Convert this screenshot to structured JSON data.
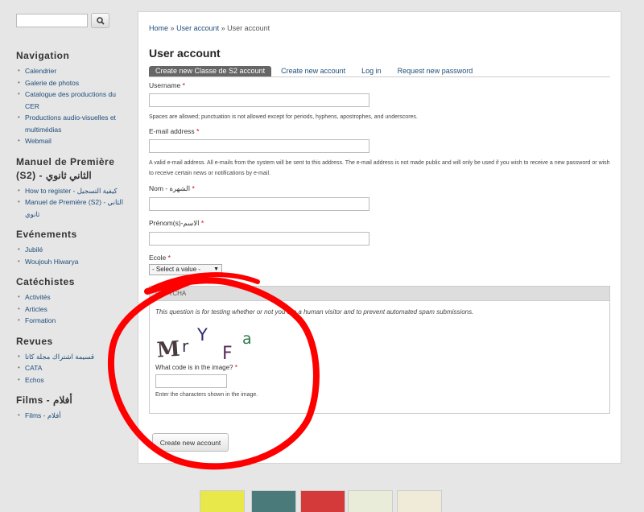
{
  "search": {
    "value": "",
    "button_icon": "search-icon"
  },
  "sidebar": {
    "blocks": [
      {
        "title": "Navigation",
        "items": [
          "Calendrier",
          "Galerie de photos",
          "Catalogue des productions du CER",
          "Productions audio-visuelles et multimédias",
          "Webmail"
        ]
      },
      {
        "title": "Manuel de Première (S2) - الثاني ثانوي",
        "items": [
          "How to register - كيفية التسجيل",
          "Manuel de Première (S2) - الثاني ثانوي"
        ]
      },
      {
        "title": "Evénements",
        "items": [
          "Jubilé",
          "Woujouh Hiwarya"
        ]
      },
      {
        "title": "Catéchistes",
        "items": [
          "Activités",
          "Articles",
          "Formation"
        ]
      },
      {
        "title": "Revues",
        "items": [
          "قسيمة اشتراك مجلة كاتا",
          "CATA",
          "Echos"
        ]
      },
      {
        "title": "Films - أفلام",
        "items": [
          "Films - أفلام"
        ]
      }
    ]
  },
  "breadcrumb": {
    "home": "Home",
    "sep1": "»",
    "user_account": "User account",
    "sep2": "»",
    "current": "User account"
  },
  "page_title": "User account",
  "tabs": [
    "Create new Classe de S2 account",
    "Create new account",
    "Log in",
    "Request new password"
  ],
  "form": {
    "username": {
      "label": "Username",
      "required": "*",
      "value": "",
      "description": "Spaces are allowed; punctuation is not allowed except for periods, hyphens, apostrophes, and underscores."
    },
    "email": {
      "label": "E-mail address",
      "required": "*",
      "value": "",
      "description": "A valid e-mail address. All e-mails from the system will be sent to this address. The e-mail address is not made public and will only be used if you wish to receive a new password or wish to receive certain news or notifications by e-mail."
    },
    "nom": {
      "label": "Nom - الشهرة",
      "required": "*",
      "value": ""
    },
    "prenom": {
      "label": "Prénom(s)-الاسم",
      "required": "*",
      "value": ""
    },
    "ecole": {
      "label": "Ecole",
      "required": "*",
      "selected": "- Select a value -"
    },
    "captcha": {
      "legend": "CAPTCHA",
      "description": "This question is for testing whether or not you are a human visitor and to prevent automated spam submissions.",
      "image_text": "MrYFa",
      "question": "What code is in the image?",
      "required": "*",
      "value": "",
      "help": "Enter the characters shown in the image."
    },
    "submit_label": "Create new account"
  },
  "colors": {
    "link": "#1e4d7b",
    "active_tab": "#666666",
    "annotation": "#ff0000",
    "required": "#cc0000"
  }
}
